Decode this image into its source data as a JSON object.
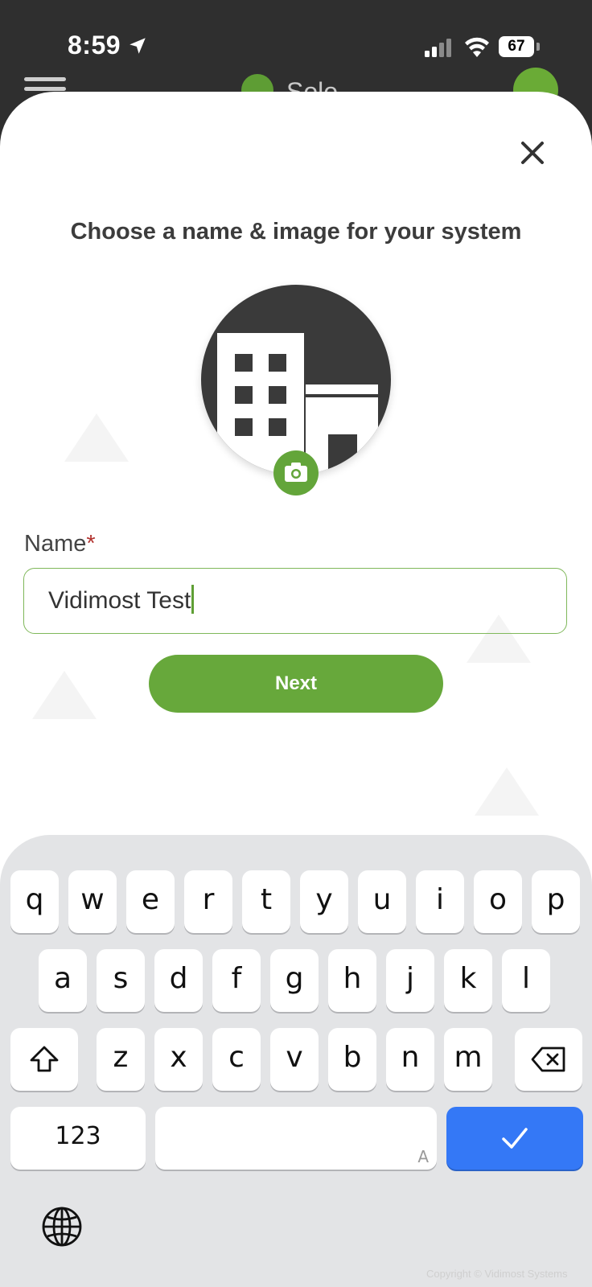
{
  "status_bar": {
    "time": "8:59",
    "battery": "67",
    "icons": [
      "location-arrow-icon",
      "cellular-signal-icon",
      "wifi-icon",
      "battery-icon"
    ]
  },
  "app_header": {
    "logo_text": "Solo",
    "icons": [
      "hamburger-menu-icon",
      "app-logo-icon",
      "add-icon"
    ]
  },
  "dialog": {
    "title": "Choose a name & image for your system",
    "image_icon": "building-icon",
    "camera_icon": "camera-icon",
    "name_label": "Name",
    "required_marker": "*",
    "name_value": "Vidimost Test",
    "next_label": "Next",
    "close_icon": "close-icon"
  },
  "keyboard": {
    "row1": [
      "q",
      "w",
      "e",
      "r",
      "t",
      "y",
      "u",
      "i",
      "o",
      "p"
    ],
    "row2": [
      "a",
      "s",
      "d",
      "f",
      "g",
      "h",
      "j",
      "k",
      "l"
    ],
    "row3": [
      "z",
      "x",
      "c",
      "v",
      "b",
      "n",
      "m"
    ],
    "numbers_label": "123",
    "space_hint": "A",
    "icons": [
      "shift-icon",
      "backspace-icon",
      "checkmark-icon",
      "globe-icon"
    ]
  },
  "colors": {
    "brand_green": "#67a83b",
    "done_blue": "#3478f6",
    "required_red": "#b2332f"
  },
  "watermark": "Copyright © Vidimost Systems"
}
